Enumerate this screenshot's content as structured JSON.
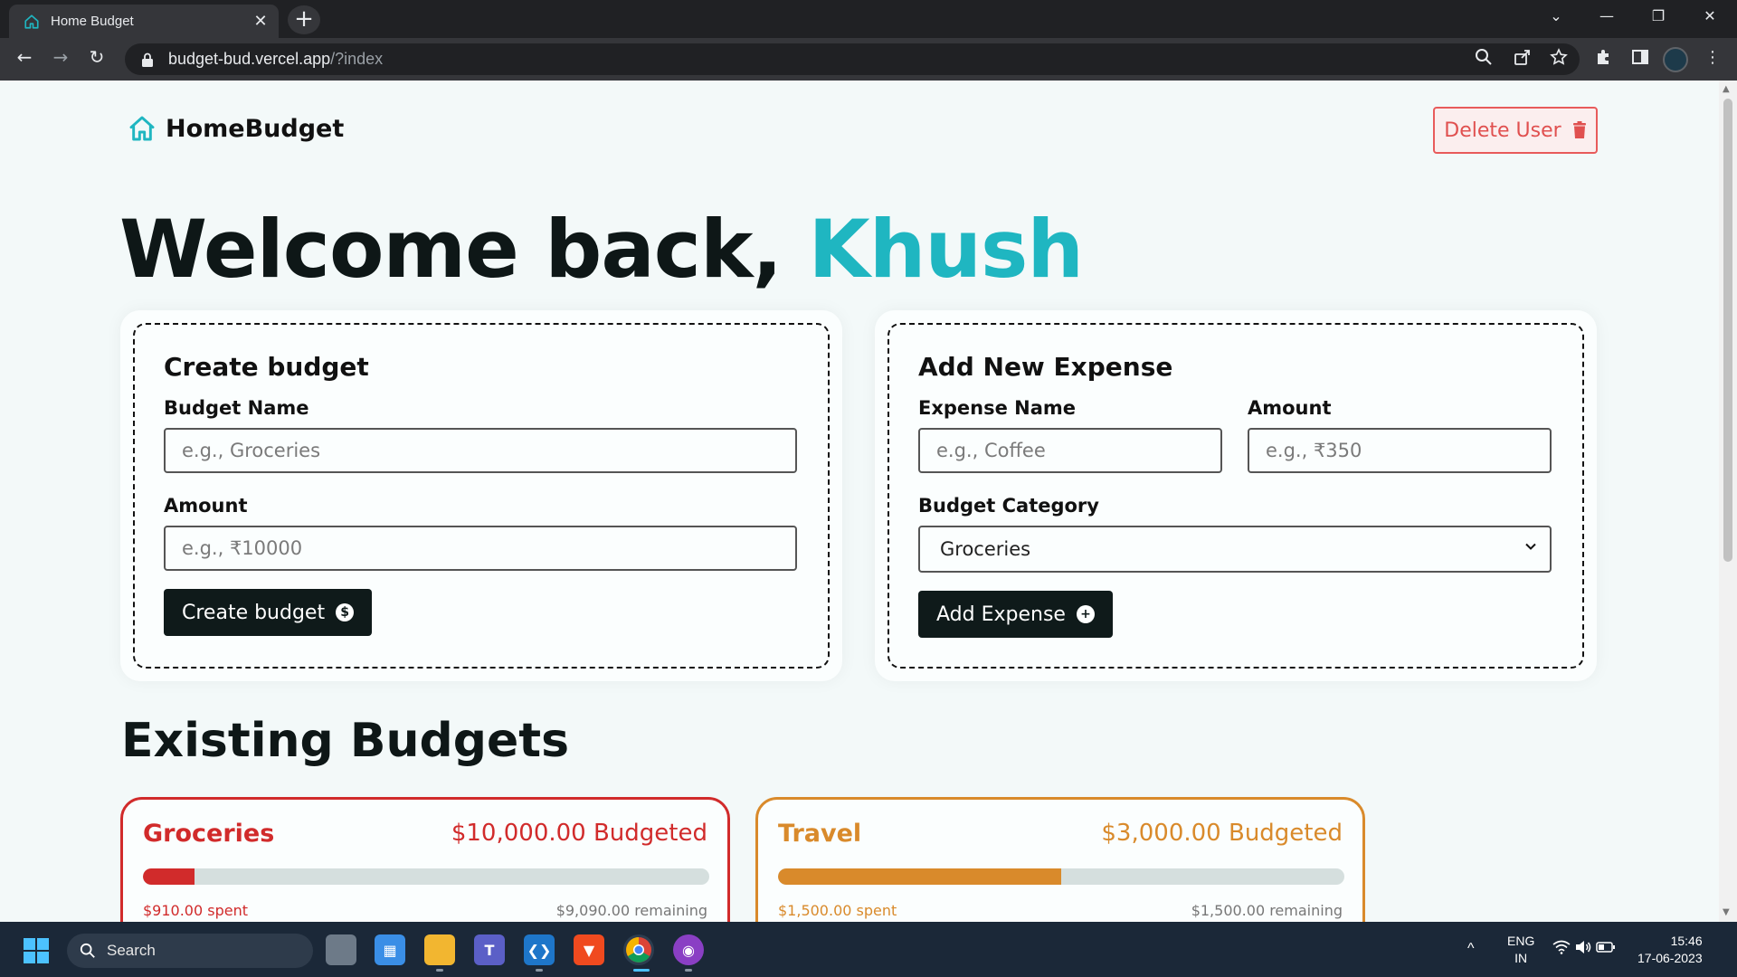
{
  "browser": {
    "tab_title": "Home Budget",
    "tab_close": "✕",
    "new_tab": "+",
    "url_host": "budget-bud.vercel.app",
    "url_path": "/?index",
    "window_controls": {
      "dropdown": "⌄",
      "minimize": "—",
      "restore": "❐",
      "close": "✕"
    },
    "nav": {
      "back": "←",
      "forward": "→",
      "reload": "↻"
    }
  },
  "header": {
    "logo_text": "HomeBudget",
    "delete_user_label": "Delete User"
  },
  "welcome": {
    "greeting": "Welcome back, ",
    "user_name": "Khush"
  },
  "create_budget": {
    "title": "Create budget",
    "name_label": "Budget Name",
    "name_placeholder": "e.g., Groceries",
    "amount_label": "Amount",
    "amount_placeholder": "e.g., ₹10000",
    "button_label": "Create budget",
    "button_icon": "$"
  },
  "add_expense": {
    "title": "Add New Expense",
    "name_label": "Expense Name",
    "name_placeholder": "e.g., Coffee",
    "amount_label": "Amount",
    "amount_placeholder": "e.g., ₹350",
    "category_label": "Budget Category",
    "category_selected": "Groceries",
    "button_label": "Add Expense",
    "button_icon": "+"
  },
  "budgets": {
    "section_title": "Existing Budgets",
    "items": [
      {
        "name": "Groceries",
        "budgeted": "$10,000.00 Budgeted",
        "spent": "$910.00 spent",
        "remaining": "$9,090.00 remaining",
        "progress": 0.091,
        "color": "#d12b2b"
      },
      {
        "name": "Travel",
        "budgeted": "$3,000.00 Budgeted",
        "spent": "$1,500.00 spent",
        "remaining": "$1,500.00 remaining",
        "progress": 0.5,
        "color": "#d98a2b"
      }
    ]
  },
  "taskbar": {
    "search_label": "Search",
    "language": "ENG",
    "region": "IN",
    "time": "15:46",
    "date": "17-06-2023",
    "tray_arrow": "^"
  },
  "colors": {
    "accent": "#1fb6c1",
    "danger": "#e0504f",
    "dark": "#0f1a1a"
  }
}
